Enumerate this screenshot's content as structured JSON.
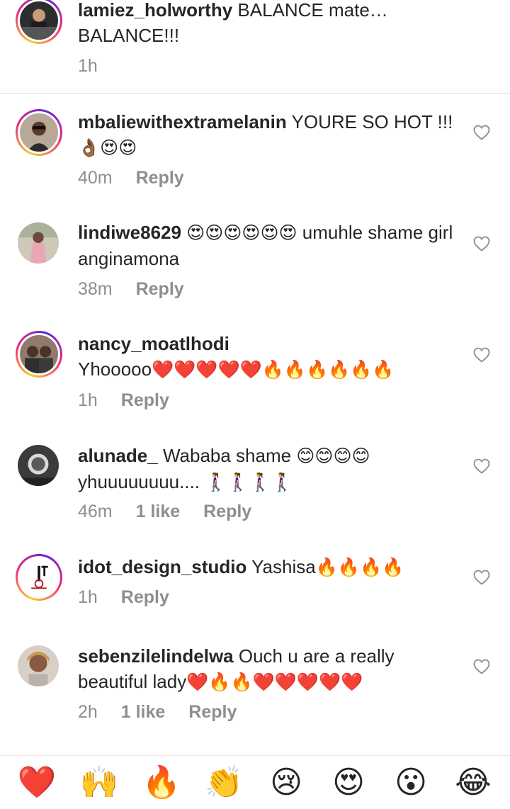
{
  "comments": [
    {
      "user": "lamiez_holworthy",
      "text": "BALANCE mate… BALANCE!!!",
      "time": "1h",
      "likes": "",
      "reply": "",
      "has_story_ring": true,
      "avatar_bg": "#2d2d2d"
    },
    {
      "user": "mbaliewithextramelanin",
      "text": "YOURE SO HOT !!! ",
      "emoji": "👌🏾😍😍",
      "time": "40m",
      "likes": "",
      "reply": "Reply",
      "has_story_ring": true,
      "avatar_bg": "#a28d7e"
    },
    {
      "user": "lindiwe8629",
      "text": " umuhle shame girl anginamona",
      "emoji": "😍😍😍😍😍😍",
      "time": "38m",
      "likes": "",
      "reply": "Reply",
      "has_story_ring": false,
      "avatar_bg": "#cfc7b8"
    },
    {
      "user": "nancy_moatlhodi",
      "text": "Yhooooo",
      "emoji": "❤️❤️❤️❤️❤️🔥🔥🔥🔥🔥🔥",
      "time": "1h",
      "likes": "",
      "reply": "Reply",
      "has_story_ring": true,
      "avatar_bg": "#6b5a4f"
    },
    {
      "user": "alunade_",
      "text": "Wababa shame ",
      "emoji": "😊😊😊😊",
      "text2": " yhuuuuuuuu.... ",
      "emoji2": "🚶‍♀️🚶‍♀️🚶‍♀️🚶‍♀️",
      "time": "46m",
      "likes": "1 like",
      "reply": "Reply",
      "has_story_ring": false,
      "avatar_bg": "#4a4a4a"
    },
    {
      "user": "idot_design_studio",
      "text": "Yashisa",
      "emoji": "🔥🔥🔥🔥",
      "time": "1h",
      "likes": "",
      "reply": "Reply",
      "has_story_ring": true,
      "avatar_bg": "#ffffff"
    },
    {
      "user": "sebenzilelindelwa",
      "text": "Ouch u are a really beautiful lady",
      "emoji": "❤️🔥🔥❤️❤️❤️❤️❤️",
      "time": "2h",
      "likes": "1 like",
      "reply": "Reply",
      "has_story_ring": false,
      "avatar_bg": "#8a6a55"
    }
  ],
  "reactions": [
    "❤️",
    "🙌",
    "🔥",
    "👏",
    "😢",
    "😍",
    "😮",
    "😂"
  ],
  "colors": {
    "secondary_text": "#8e8e8e",
    "primary_text": "#262626",
    "divider": "#dbdbdb"
  }
}
